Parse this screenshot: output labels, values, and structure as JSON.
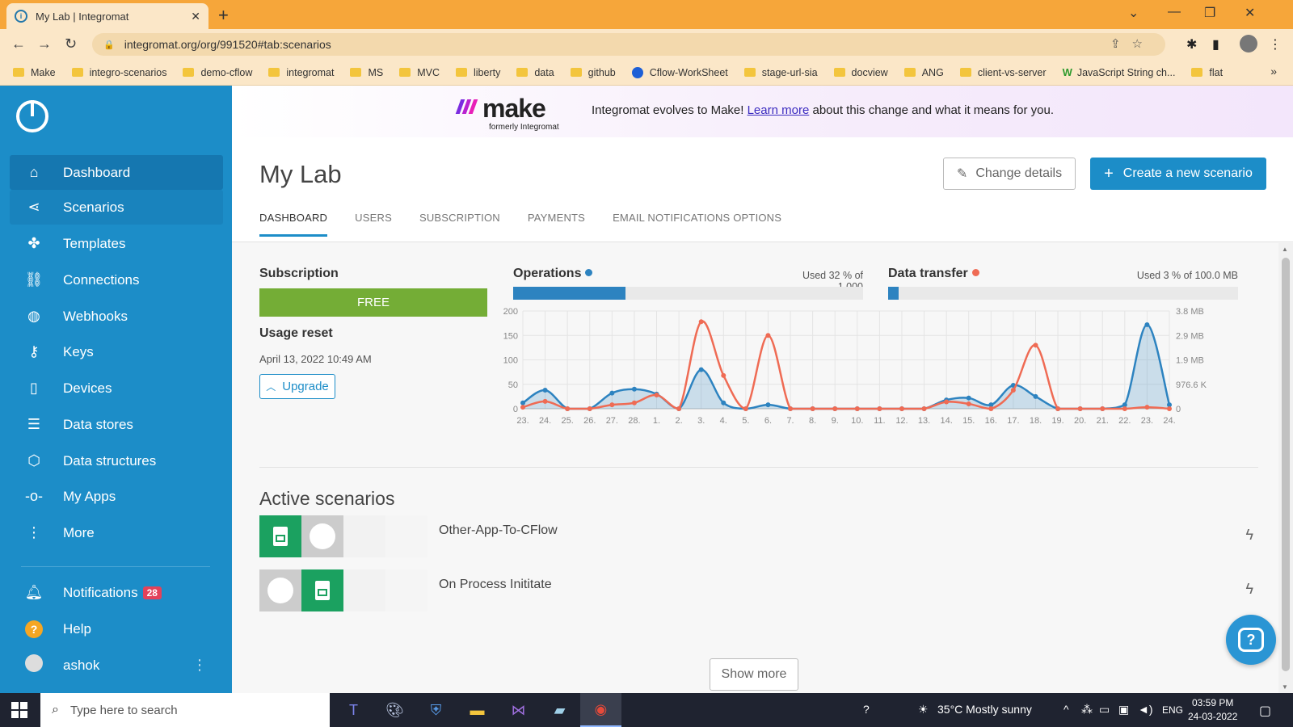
{
  "browser": {
    "tab_title": "My Lab | Integromat",
    "url": "integromat.org/org/991520#tab:scenarios",
    "bookmarks": [
      "Make",
      "integro-scenarios",
      "demo-cflow",
      "integromat",
      "MS",
      "MVC",
      "liberty",
      "data",
      "github",
      "Cflow-WorkSheet",
      "stage-url-sia",
      "docview",
      "ANG",
      "client-vs-server",
      "JavaScript String ch...",
      "flat"
    ]
  },
  "sidebar": {
    "items": [
      {
        "label": "Dashboard",
        "icon": "home-icon"
      },
      {
        "label": "Scenarios",
        "icon": "share-icon"
      },
      {
        "label": "Templates",
        "icon": "puzzle-icon"
      },
      {
        "label": "Connections",
        "icon": "link-icon"
      },
      {
        "label": "Webhooks",
        "icon": "globe-icon"
      },
      {
        "label": "Keys",
        "icon": "key-icon"
      },
      {
        "label": "Devices",
        "icon": "phone-icon"
      },
      {
        "label": "Data stores",
        "icon": "database-icon"
      },
      {
        "label": "Data structures",
        "icon": "cube-icon"
      },
      {
        "label": "My Apps",
        "icon": "node-icon"
      },
      {
        "label": "More",
        "icon": "dots-vertical-icon"
      }
    ],
    "notifications_label": "Notifications",
    "notifications_count": "28",
    "help_label": "Help",
    "user_name": "ashok"
  },
  "banner": {
    "brand": "make",
    "brand_sub": "formerly Integromat",
    "text_before": "Integromat evolves to Make! ",
    "link": "Learn more",
    "text_after": " about this change and what it means for you."
  },
  "header": {
    "title": "My Lab",
    "change_details": "Change details",
    "create_scenario": "Create a new scenario",
    "tabs": [
      "DASHBOARD",
      "USERS",
      "SUBSCRIPTION",
      "PAYMENTS",
      "EMAIL NOTIFICATIONS OPTIONS"
    ]
  },
  "subscription": {
    "title": "Subscription",
    "plan": "FREE",
    "reset_title": "Usage reset",
    "reset_date": "April 13, 2022 10:49 AM",
    "upgrade": "Upgrade"
  },
  "operations": {
    "title": "Operations",
    "usage_text": "Used 32 % of 1,000",
    "percent": 32,
    "color": "#2d83c0"
  },
  "data_transfer": {
    "title": "Data transfer",
    "usage_text": "Used 3 % of 100.0 MB",
    "percent": 3,
    "color": "#ef6b54"
  },
  "chart_data": {
    "type": "area",
    "categories": [
      "23.",
      "24.",
      "25.",
      "26.",
      "27.",
      "28.",
      "1.",
      "2.",
      "3.",
      "4.",
      "5.",
      "6.",
      "7.",
      "8.",
      "9.",
      "10.",
      "11.",
      "12.",
      "13.",
      "14.",
      "15.",
      "16.",
      "17.",
      "18.",
      "19.",
      "20.",
      "21.",
      "22.",
      "23.",
      "24."
    ],
    "y_left_ticks": [
      "200",
      "150",
      "100",
      "50",
      "0"
    ],
    "y_right_ticks": [
      "3.8 MB",
      "2.9 MB",
      "1.9 MB",
      "976.6 K",
      "0"
    ],
    "ylim": [
      0,
      200
    ],
    "series": [
      {
        "name": "Operations",
        "color": "#2d83c0",
        "values": [
          12,
          38,
          0,
          0,
          32,
          40,
          30,
          0,
          80,
          12,
          0,
          8,
          0,
          0,
          0,
          0,
          0,
          0,
          0,
          18,
          22,
          8,
          48,
          25,
          0,
          0,
          0,
          8,
          172,
          8
        ]
      },
      {
        "name": "Data transfer",
        "color": "#ef6b54",
        "values": [
          3,
          15,
          0,
          0,
          8,
          12,
          28,
          0,
          178,
          68,
          0,
          150,
          0,
          0,
          0,
          0,
          0,
          0,
          0,
          14,
          10,
          0,
          38,
          130,
          0,
          0,
          0,
          0,
          3,
          0
        ]
      }
    ]
  },
  "active_scenarios": {
    "title": "Active scenarios",
    "items": [
      {
        "name": "Other-App-To-CFlow"
      },
      {
        "name": "On Process Inititate"
      }
    ],
    "show_more": "Show more"
  },
  "taskbar": {
    "search_placeholder": "Type here to search",
    "weather": "35°C  Mostly sunny",
    "lang": "ENG",
    "time": "03:59 PM",
    "date": "24-03-2022"
  }
}
